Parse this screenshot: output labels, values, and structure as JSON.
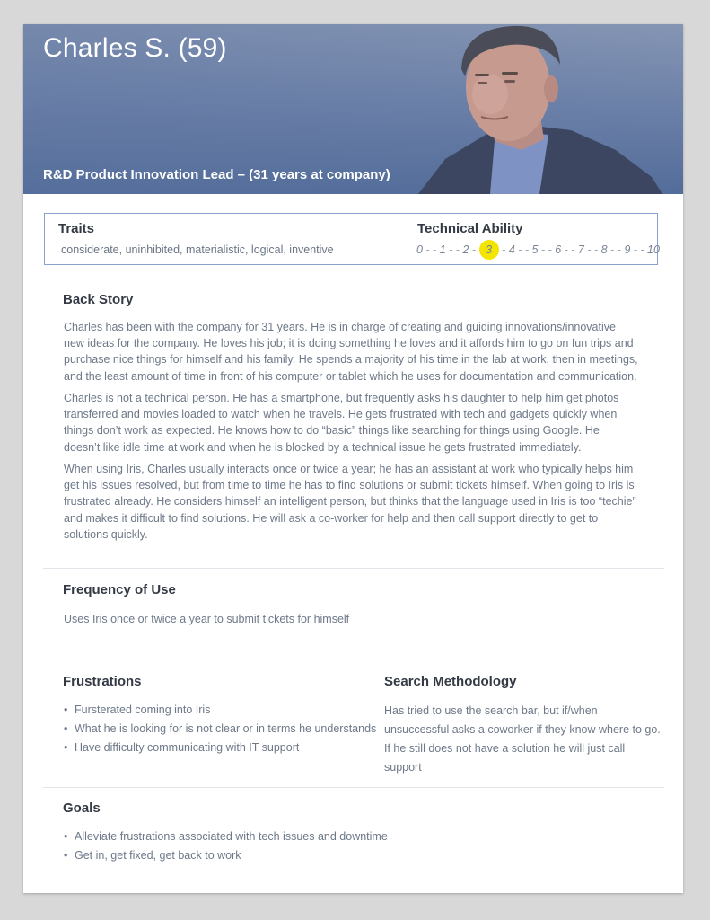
{
  "persona": {
    "name": "Charles S. (59)",
    "role": "R&D Product Innovation Lead – (31 years at company)"
  },
  "traits": {
    "title": "Traits",
    "text": "considerate,  uninhibited,  materialistic,  logical,  inventive"
  },
  "technical_ability": {
    "title": "Technical Ability",
    "scale": [
      "0",
      "1",
      "2",
      "3",
      "4",
      "5",
      "6",
      "7",
      "8",
      "9",
      "10"
    ],
    "separator": "- -",
    "selected": 3,
    "highlight_color": "#f3e500"
  },
  "back_story": {
    "title": "Back Story",
    "paragraphs": [
      "Charles has been with the company for 31 years. He is in charge of creating and guiding innovations/innovative new ideas for the company. He loves his job; it is doing something he loves and it affords him to go on fun trips and purchase nice things for himself and his family. He spends a majority of his time in the lab at work, then in meetings, and the least amount of time in front of his computer or tablet which he uses for documentation and communication.",
      "Charles is not a technical person. He has a smartphone, but frequently asks his daughter to help him get photos transferred and movies loaded to watch when he travels. He gets frustrated with tech and gadgets quickly when things don’t work as expected. He knows how to do “basic” things like searching for things using Google. He doesn’t like idle time at work and when he is blocked by a technical issue he gets frustrated immediately.",
      "When using Iris, Charles usually interacts once or twice a year; he has an assistant at work who typically helps him get his issues resolved, but from time to time he has to find solutions or submit tickets himself. When going to Iris is frustrated already. He considers himself an intelligent person, but thinks that the language used in Iris is too “techie” and makes it difficult to find solutions. He will ask a co-worker for help and then call support directly to get to solutions quickly."
    ]
  },
  "frequency": {
    "title": "Frequency of Use",
    "text": "Uses Iris once or twice a year to submit tickets for himself"
  },
  "frustrations": {
    "title": "Frustrations",
    "items": [
      "Fursterated coming into Iris",
      "What he is looking for is not clear or in terms he understands",
      "Have difficulty communicating with IT support"
    ]
  },
  "search_methodology": {
    "title": "Search Methodology",
    "text": "Has tried to use the search bar, but if/when unsuccessful asks a coworker if they know where to go. If he still does not have a solution he will just call support"
  },
  "goals": {
    "title": "Goals",
    "items": [
      "Alleviate frustrations associated with tech issues and downtime",
      "Get in, get fixed, get back to work"
    ]
  }
}
